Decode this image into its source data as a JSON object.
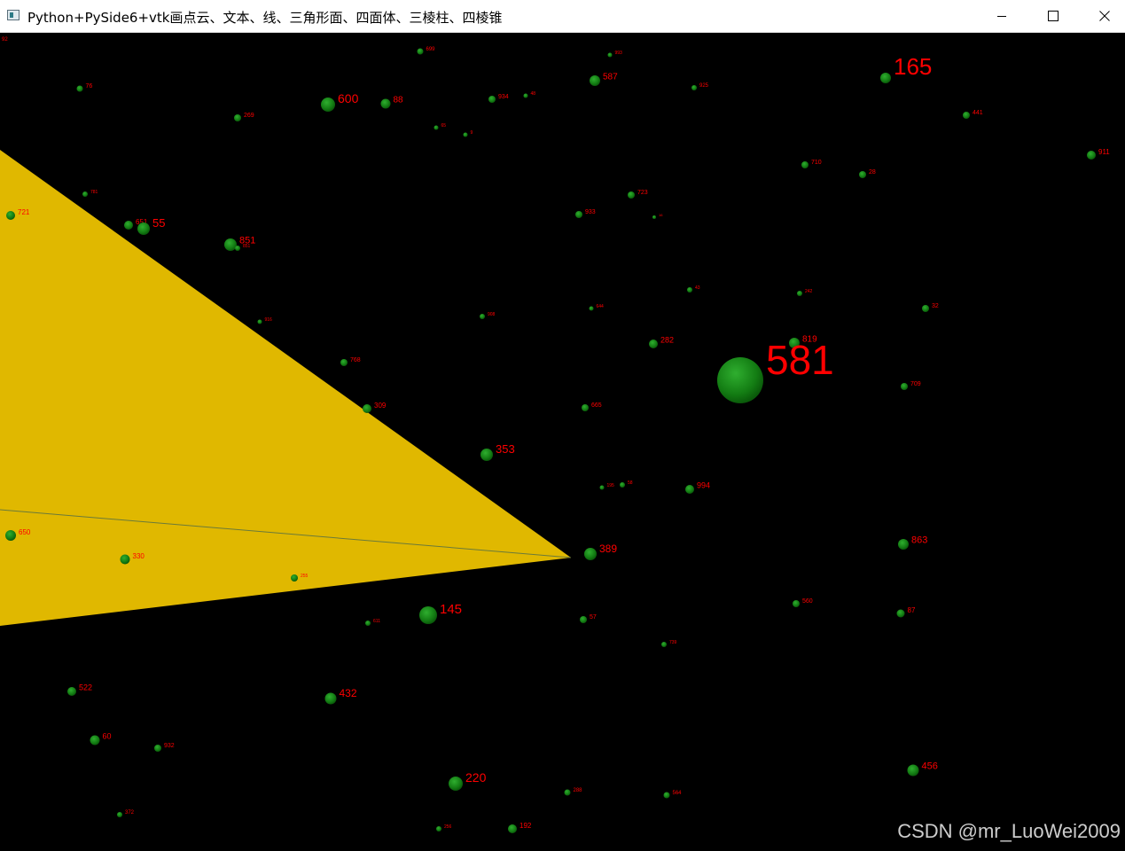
{
  "window": {
    "title": "Python+PySide6+vtk画点云、文本、线、三角形面、四面体、三棱柱、四棱锥",
    "icon": "app-window-icon",
    "controls": [
      "minimize-icon",
      "maximize-icon",
      "close-icon"
    ]
  },
  "scene": {
    "background": "#000000",
    "point_color": "#1a8a1a",
    "label_color": "#ff0000",
    "triangle_color": "#e0b800",
    "points": [
      {
        "label": "92"
      },
      {
        "label": "699"
      },
      {
        "label": "993"
      },
      {
        "label": "76"
      },
      {
        "label": "587"
      },
      {
        "label": "925"
      },
      {
        "label": "165"
      },
      {
        "label": "600"
      },
      {
        "label": "88"
      },
      {
        "label": "934"
      },
      {
        "label": "48"
      },
      {
        "label": "269"
      },
      {
        "label": "65"
      },
      {
        "label": "9"
      },
      {
        "label": "441"
      },
      {
        "label": "911"
      },
      {
        "label": "710"
      },
      {
        "label": "28"
      },
      {
        "label": "781"
      },
      {
        "label": "723"
      },
      {
        "label": "721"
      },
      {
        "label": "933"
      },
      {
        "label": "16"
      },
      {
        "label": "651"
      },
      {
        "label": "55"
      },
      {
        "label": "851"
      },
      {
        "label": "43"
      },
      {
        "label": "242"
      },
      {
        "label": "32"
      },
      {
        "label": "916"
      },
      {
        "label": "908"
      },
      {
        "label": "644"
      },
      {
        "label": "282"
      },
      {
        "label": "819"
      },
      {
        "label": "581"
      },
      {
        "label": "768"
      },
      {
        "label": "851"
      },
      {
        "label": "709"
      },
      {
        "label": "309"
      },
      {
        "label": "665"
      },
      {
        "label": "353"
      },
      {
        "label": "195"
      },
      {
        "label": "58"
      },
      {
        "label": "994"
      },
      {
        "label": "650"
      },
      {
        "label": "863"
      },
      {
        "label": "330"
      },
      {
        "label": "389"
      },
      {
        "label": "255"
      },
      {
        "label": "560"
      },
      {
        "label": "145"
      },
      {
        "label": "611"
      },
      {
        "label": "57"
      },
      {
        "label": "87"
      },
      {
        "label": "739"
      },
      {
        "label": "522"
      },
      {
        "label": "432"
      },
      {
        "label": "60"
      },
      {
        "label": "932"
      },
      {
        "label": "456"
      },
      {
        "label": "220"
      },
      {
        "label": "288"
      },
      {
        "label": "564"
      },
      {
        "label": "372"
      },
      {
        "label": "256"
      },
      {
        "label": "192"
      }
    ]
  },
  "watermark": "CSDN @mr_LuoWei2009"
}
